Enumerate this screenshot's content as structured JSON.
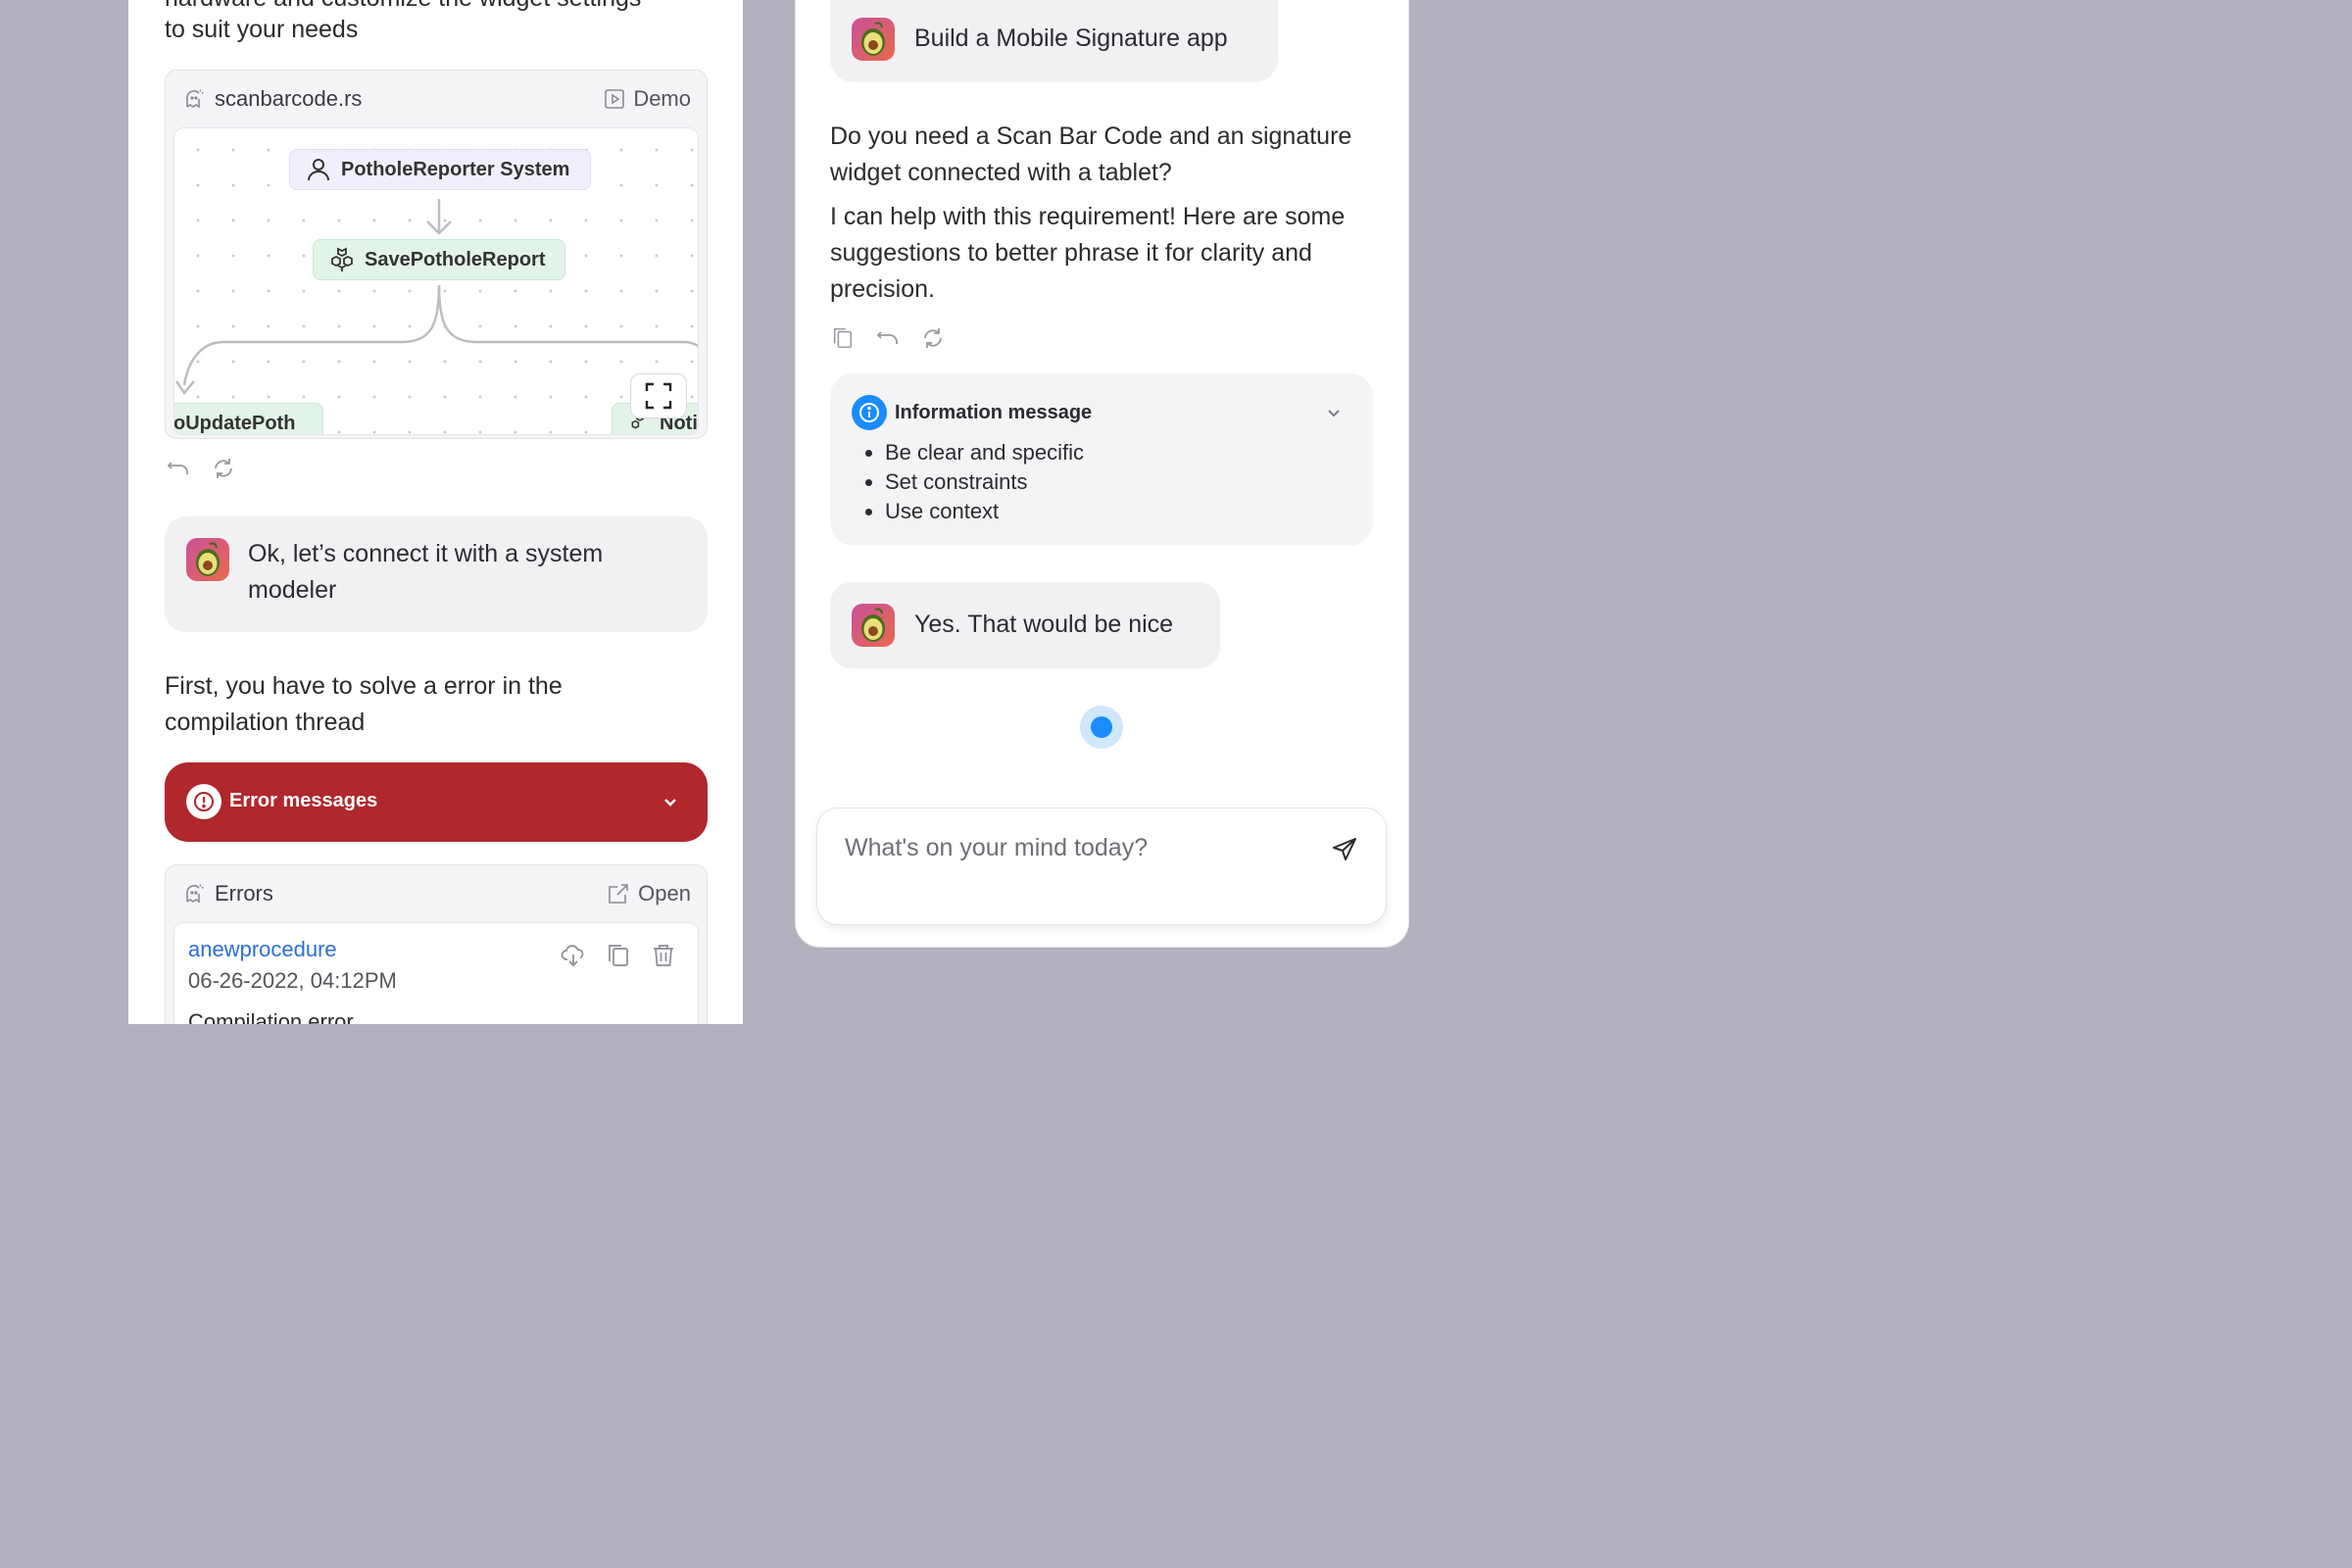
{
  "left_panel": {
    "intro_text": "to suit your needs",
    "intro_text_cut": "hardware and customize the widget settings",
    "code_card": {
      "filename": "scanbarcode.rs",
      "action_label": "Demo",
      "diagram": {
        "nodes": [
          {
            "label": "PotholeReporter System",
            "icon": "user-icon"
          },
          {
            "label": "SavePotholeReport",
            "icon": "cubes-icon"
          },
          {
            "label": "oUpdatePoth",
            "icon": "none"
          },
          {
            "label": "Noti",
            "icon": "cubes-icon"
          }
        ]
      }
    },
    "assistant_message": "Ok, let’s connect it with a system modeler",
    "bot_text": "First, you have to solve a error in the compilation thread",
    "error_bar": {
      "label": "Error messages",
      "color": "#b0272c"
    },
    "errors_card": {
      "title": "Errors",
      "action_label": "Open",
      "item": {
        "name": "anewprocedure",
        "date": "06-26-2022, 04:12PM",
        "description": "Compilation error"
      }
    }
  },
  "right_panel": {
    "user_message_1": "Build a Mobile Signature app",
    "bot_question": "Do you need a Scan Bar Code and an signature widget connected with a tablet?",
    "bot_answer": "I can help with this requirement! Here are some suggestions to better phrase it for clarity and precision.",
    "info_card": {
      "title": "Information message",
      "items": [
        "Be clear and specific",
        "Set constraints",
        "Use context"
      ]
    },
    "user_message_2": "Yes. That would be nice",
    "input": {
      "placeholder": "What's on your mind today?"
    }
  },
  "colors": {
    "accent": "#1a8cff",
    "error": "#b0272c",
    "link": "#2a6fd6",
    "background": "#b3b1bd"
  }
}
